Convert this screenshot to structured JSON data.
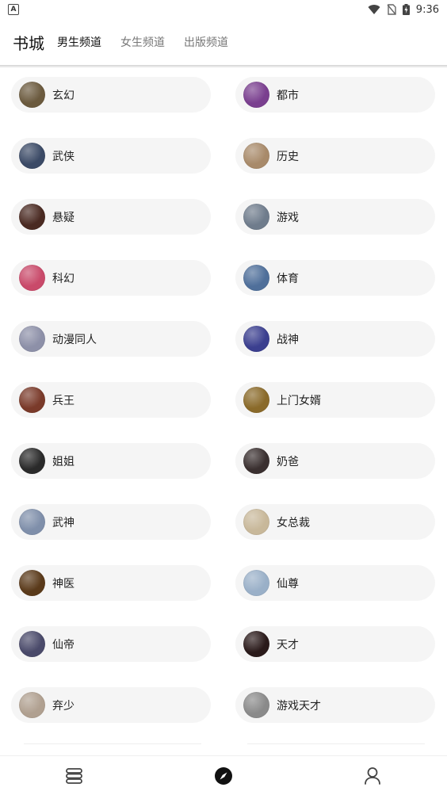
{
  "status_bar": {
    "time": "9:36"
  },
  "header": {
    "title": "书城",
    "tabs": [
      {
        "label": "男生频道",
        "active": true
      },
      {
        "label": "女生频道",
        "active": false
      },
      {
        "label": "出版频道",
        "active": false
      }
    ]
  },
  "categories": [
    {
      "label": "玄幻",
      "cover": "#6b5a3e"
    },
    {
      "label": "都市",
      "cover": "#7a3f8f"
    },
    {
      "label": "武侠",
      "cover": "#3b4a66"
    },
    {
      "label": "历史",
      "cover": "#a88a6a"
    },
    {
      "label": "悬疑",
      "cover": "#4a2a22"
    },
    {
      "label": "游戏",
      "cover": "#6f7c8c"
    },
    {
      "label": "科幻",
      "cover": "#c94a6a"
    },
    {
      "label": "体育",
      "cover": "#4f6f9a"
    },
    {
      "label": "动漫同人",
      "cover": "#8d90a8"
    },
    {
      "label": "战神",
      "cover": "#3b3f8f"
    },
    {
      "label": "兵王",
      "cover": "#7a3a2a"
    },
    {
      "label": "上门女婿",
      "cover": "#8a6a2a"
    },
    {
      "label": "姐姐",
      "cover": "#2a2a2a"
    },
    {
      "label": "奶爸",
      "cover": "#3a3030"
    },
    {
      "label": "武神",
      "cover": "#7f8faa"
    },
    {
      "label": "女总裁",
      "cover": "#c8b89a"
    },
    {
      "label": "神医",
      "cover": "#5a3a1a"
    },
    {
      "label": "仙尊",
      "cover": "#9ab0c8"
    },
    {
      "label": "仙帝",
      "cover": "#4a4a6a"
    },
    {
      "label": "天才",
      "cover": "#2a1a1a"
    },
    {
      "label": "弃少",
      "cover": "#b0a090"
    },
    {
      "label": "游戏天才",
      "cover": "#8a8a8a"
    }
  ],
  "bottom_nav": [
    {
      "name": "bookshelf-icon"
    },
    {
      "name": "discover-compass-icon",
      "active": true
    },
    {
      "name": "profile-icon"
    }
  ]
}
